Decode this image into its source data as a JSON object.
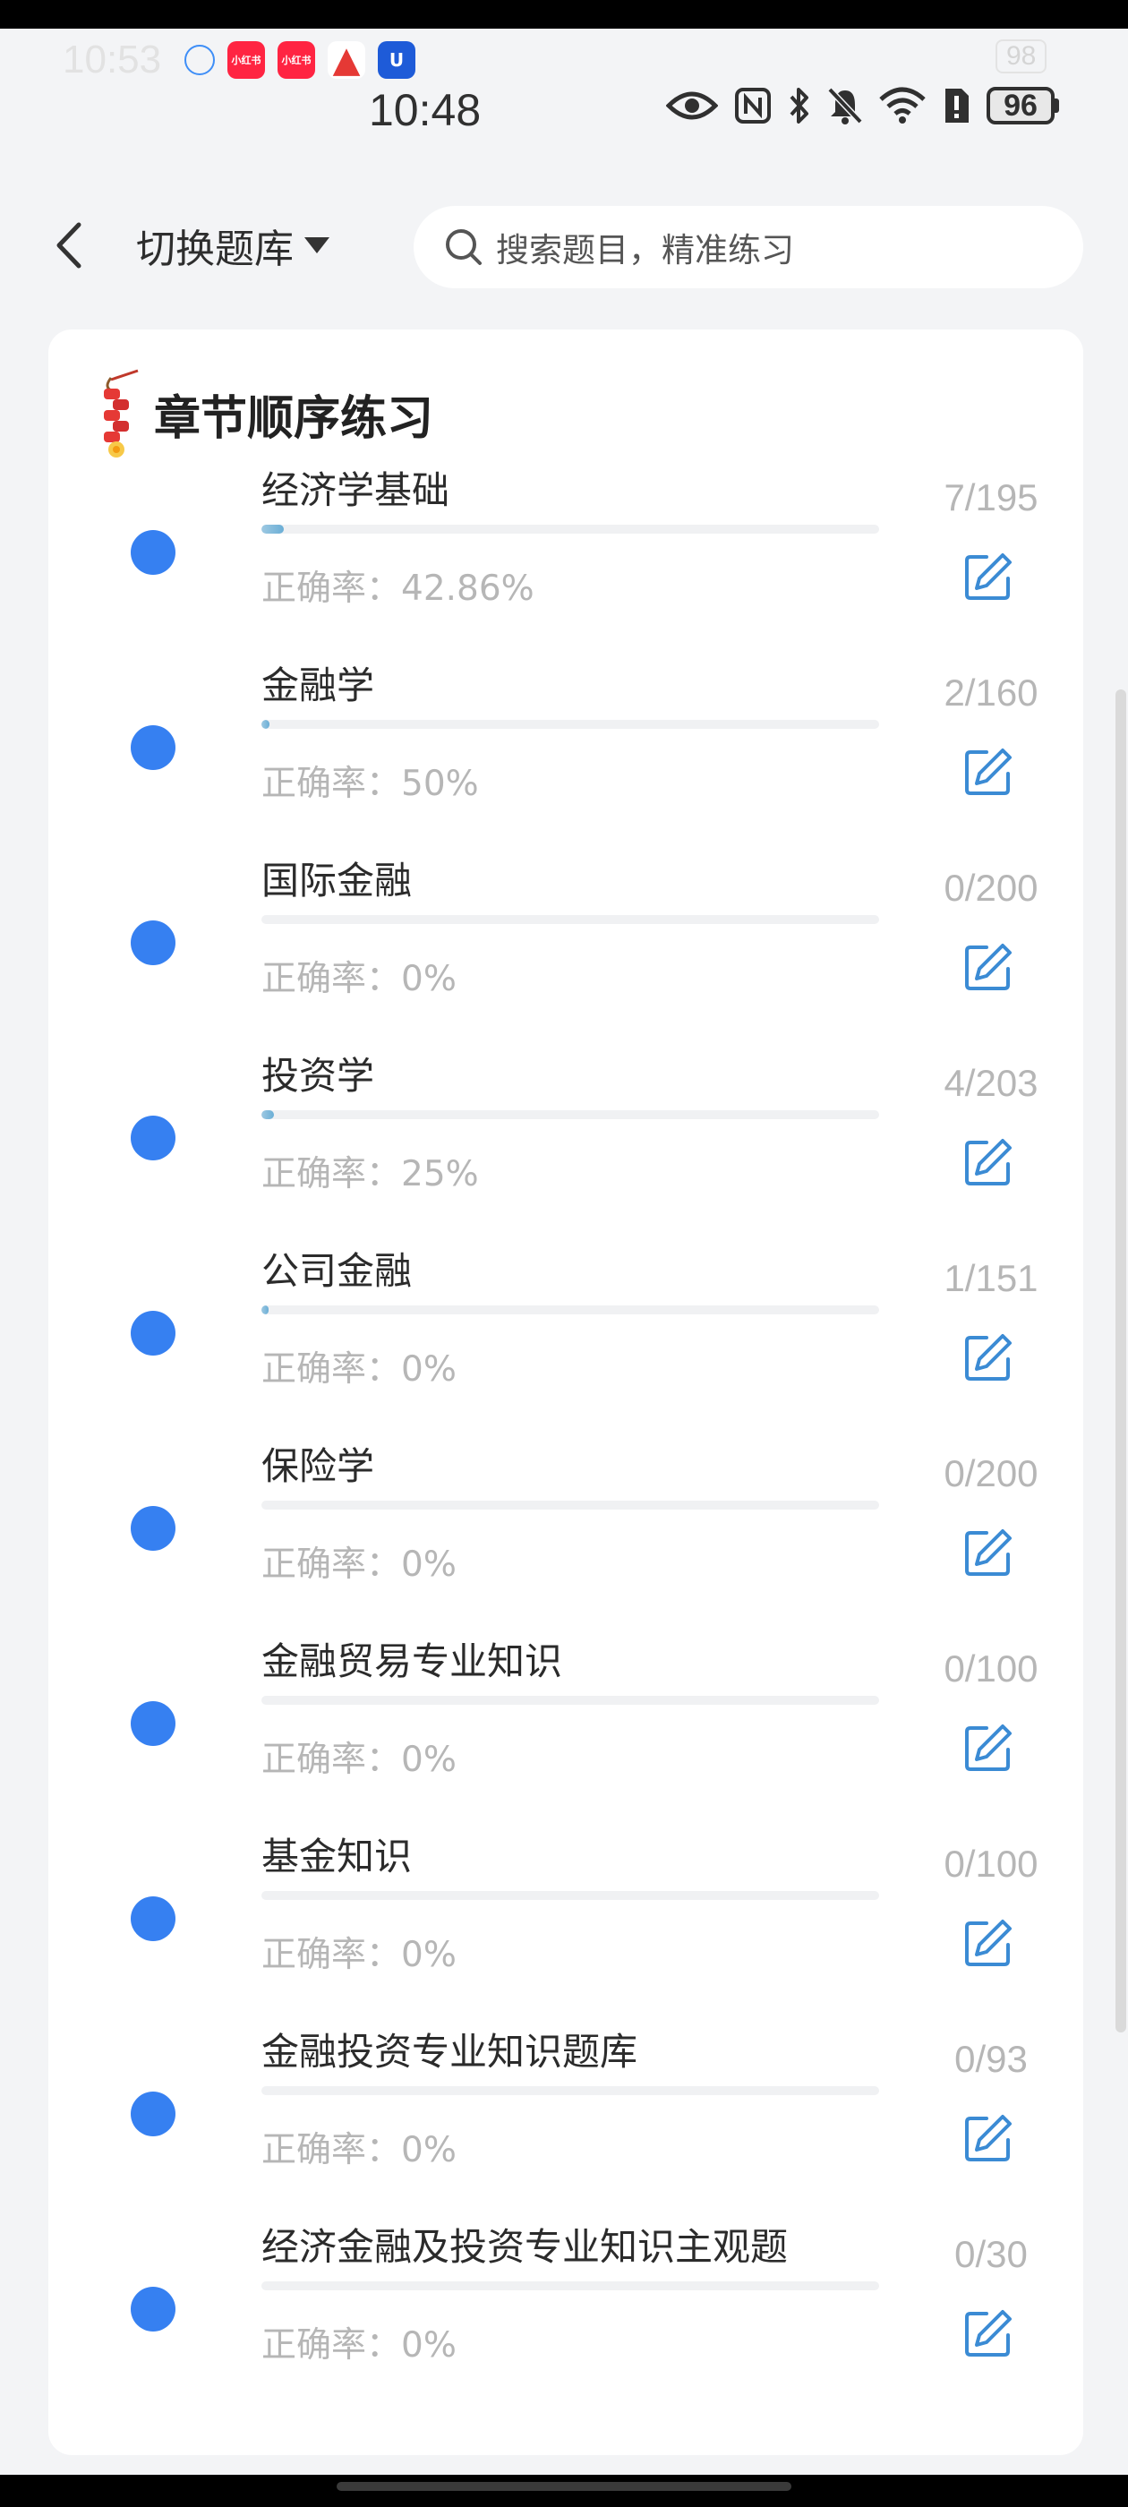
{
  "status_bar": {
    "ghost_time": "10:53",
    "ghost_battery": "98",
    "notification_icons": [
      {
        "icon": "link-app-icon",
        "label": ""
      },
      {
        "icon": "xiaohongshu-icon",
        "label": "小红书"
      },
      {
        "icon": "xiaohongshu-icon",
        "label": "小红书"
      },
      {
        "icon": "triangle-app-icon",
        "label": "▲"
      },
      {
        "icon": "shield-app-icon",
        "label": "U"
      }
    ],
    "time": "10:48",
    "battery": "96",
    "system_icons": [
      "eye-icon",
      "nfc-icon",
      "bluetooth-icon",
      "mute-icon",
      "wifi-icon",
      "sim-alert-icon"
    ]
  },
  "header": {
    "back_icon": "chevron-left-icon",
    "switch_label": "切换题库",
    "switch_icon": "caret-down-icon",
    "search_icon": "search-icon",
    "search_placeholder": "搜索题目，精准练习"
  },
  "section": {
    "title": "章节顺序练习",
    "title_icon": "firecracker-icon"
  },
  "accuracy_label": "正确率：",
  "chapters": [
    {
      "name": "经济学基础",
      "progress": 7,
      "total": 195,
      "count": "7/195",
      "accuracy": "42.86%"
    },
    {
      "name": "金融学",
      "progress": 2,
      "total": 160,
      "count": "2/160",
      "accuracy": "50%"
    },
    {
      "name": "国际金融",
      "progress": 0,
      "total": 200,
      "count": "0/200",
      "accuracy": "0%"
    },
    {
      "name": "投资学",
      "progress": 4,
      "total": 203,
      "count": "4/203",
      "accuracy": "25%"
    },
    {
      "name": "公司金融",
      "progress": 1,
      "total": 151,
      "count": "1/151",
      "accuracy": "0%"
    },
    {
      "name": "保险学",
      "progress": 0,
      "total": 200,
      "count": "0/200",
      "accuracy": "0%"
    },
    {
      "name": "金融贸易专业知识",
      "progress": 0,
      "total": 100,
      "count": "0/100",
      "accuracy": "0%"
    },
    {
      "name": "基金知识",
      "progress": 0,
      "total": 100,
      "count": "0/100",
      "accuracy": "0%"
    },
    {
      "name": "金融投资专业知识题库",
      "progress": 0,
      "total": 93,
      "count": "0/93",
      "accuracy": "0%"
    },
    {
      "name": "经济金融及投资专业知识主观题",
      "progress": 0,
      "total": 30,
      "count": "0/30",
      "accuracy": "0%"
    }
  ],
  "colors": {
    "accent": "#3680f1",
    "edit_icon": "#3b8bd4",
    "progress_fill": "#6aaed6",
    "muted_text": "#b6b6b6"
  }
}
